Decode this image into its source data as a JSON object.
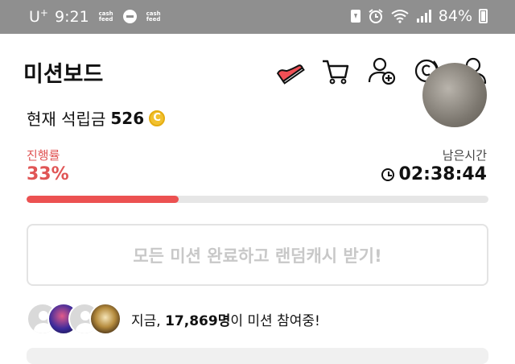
{
  "statusbar": {
    "carrier": "U",
    "carrier_sup": "+",
    "time": "9:21",
    "cashfeed_line1": "cash",
    "cashfeed_line2": "feed",
    "battery": "84%"
  },
  "header": {
    "title": "미션보드",
    "icons": [
      "shoe-icon",
      "cart-icon",
      "add-friend-icon",
      "cash-coin-icon",
      "profile-icon"
    ]
  },
  "points": {
    "label": "현재 석립금",
    "value": "526",
    "coin_symbol": "C"
  },
  "progress": {
    "label": "진행률",
    "value": "33%",
    "percent": 33,
    "remaining_label": "남은시간",
    "remaining_time": "02:38:44"
  },
  "reward_button": {
    "label": "모든 미션 완료하고 랜덤캐시 받기!"
  },
  "participants": {
    "prefix": "지금,",
    "count": "17,869명",
    "suffix": "이 미션 참여중!"
  },
  "colors": {
    "accent": "#ec5151",
    "statusbar": "#8f8f8f",
    "coin": "#f2c12e",
    "disabled_text": "#c8c8c8"
  }
}
